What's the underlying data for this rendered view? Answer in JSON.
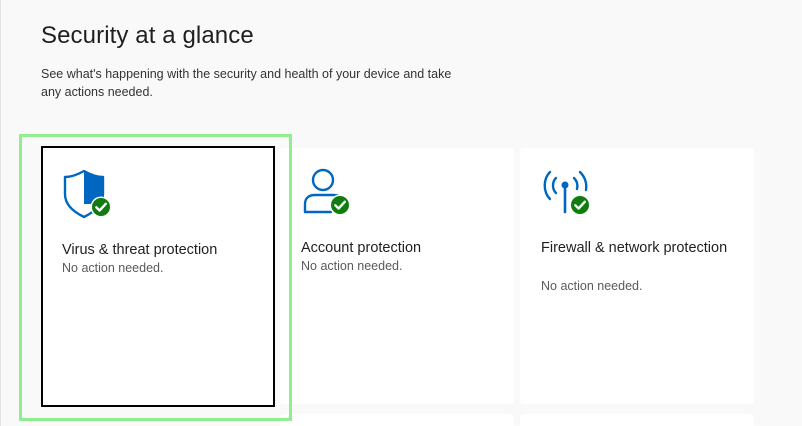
{
  "header": {
    "title": "Security at a glance",
    "subtitle": "See what's happening with the security and health of your device and take any actions needed."
  },
  "cards": [
    {
      "title": "Virus & threat protection",
      "status": "No action needed.",
      "icon": "shield-check-icon",
      "focused": true
    },
    {
      "title": "Account protection",
      "status": "No action needed.",
      "icon": "person-check-icon",
      "focused": false
    },
    {
      "title": "Firewall & network protection",
      "status": "No action needed.",
      "icon": "antenna-check-icon",
      "focused": false
    }
  ],
  "colors": {
    "accent": "#0067c0",
    "ok_badge": "#107c10",
    "focus_ring": "#90ee90",
    "background": "#f9f9f9",
    "card": "#ffffff"
  }
}
